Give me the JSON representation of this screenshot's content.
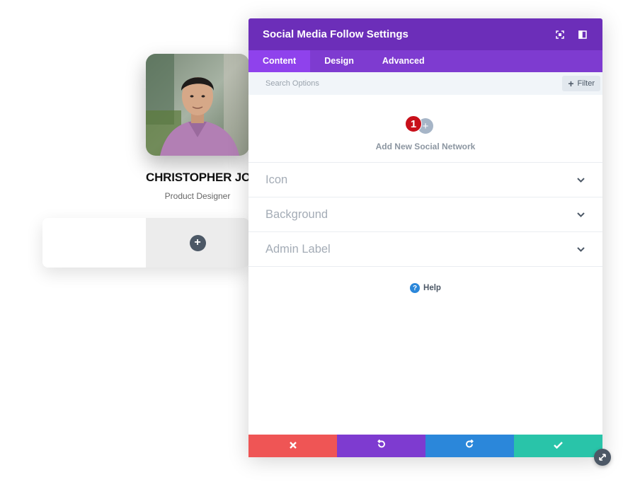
{
  "profile": {
    "name": "CHRISTOPHER JOE",
    "title": "Product Designer"
  },
  "modal": {
    "title": "Social Media Follow Settings",
    "tabs": [
      {
        "label": "Content",
        "active": true
      },
      {
        "label": "Design",
        "active": false
      },
      {
        "label": "Advanced",
        "active": false
      }
    ],
    "search": {
      "placeholder": "Search Options"
    },
    "filter_label": "Filter",
    "add_network": {
      "badge": "1",
      "label": "Add New Social Network"
    },
    "sections": [
      {
        "label": "Icon"
      },
      {
        "label": "Background"
      },
      {
        "label": "Admin Label"
      }
    ],
    "help_label": "Help"
  },
  "icons": {
    "header": [
      "focus-icon",
      "sidebar-toggle-icon"
    ],
    "footer": [
      "close-icon",
      "undo-icon",
      "redo-icon",
      "check-icon"
    ]
  },
  "colors": {
    "header": "#6c2eb9",
    "tabs": "#7e3bd0",
    "active_tab": "#8f42ec",
    "cancel": "#ef5555",
    "undo": "#7e3bd0",
    "redo": "#2b87da",
    "save": "#29c4a9",
    "badge": "#c8101a"
  }
}
